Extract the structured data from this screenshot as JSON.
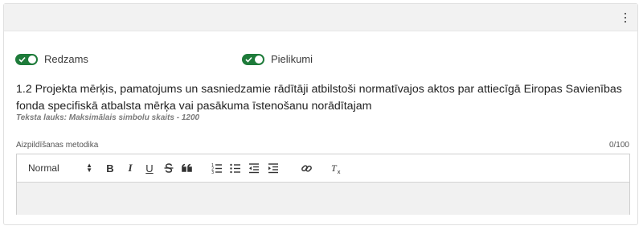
{
  "header": {
    "menu_icon": "kebab-menu-icon"
  },
  "toggles": {
    "visible": {
      "label": "Redzams",
      "on": true
    },
    "attachments": {
      "label": "Pielikumi",
      "on": true
    }
  },
  "colors": {
    "toggle_on": "#1e7b3a",
    "header_bg": "#f2f2f2",
    "editor_bg": "#f1f1f1"
  },
  "question": {
    "title": "1.2 Projekta mērķis, pamatojums un sasniedzamie rādītāji atbilstoši normatīvajos aktos par attiecīgā Eiropas Savienības fonda specifiskā atbalsta mērķa vai pasākuma īstenošanu norādītajam",
    "hint": "Teksta lauks: Maksimālais simbolu skaits - 1200"
  },
  "editor": {
    "label": "Aizpildīšanas metodika",
    "counter": "0/100",
    "format_select": "Normal",
    "toolbar_icons": [
      "bold-icon",
      "italic-icon",
      "underline-icon",
      "strikethrough-icon",
      "blockquote-icon",
      "ordered-list-icon",
      "bullet-list-icon",
      "outdent-icon",
      "indent-icon",
      "link-icon",
      "clear-format-icon"
    ],
    "bold": "B",
    "italic": "I",
    "underline": "U",
    "value": ""
  }
}
